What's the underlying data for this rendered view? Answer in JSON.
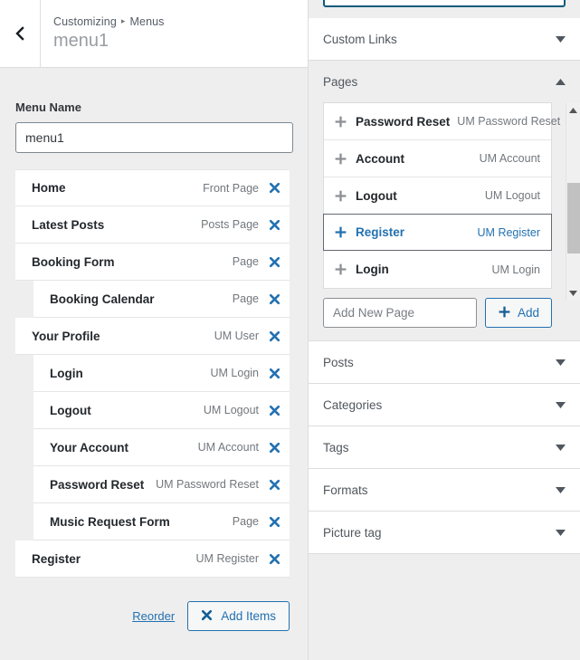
{
  "colors": {
    "accent": "#2271b1",
    "panel_bg": "#eeeeee",
    "row_bg": "#ffffff",
    "title_text": "#23282d",
    "type_text": "#72777c",
    "header_title": "#999da1",
    "focus_border": "#0d5a7d"
  },
  "left_panel": {
    "back_button_label": "Back",
    "breadcrumb": {
      "root": "Customizing",
      "separator": "▸",
      "current": "Menus"
    },
    "panel_title": "menu1",
    "menu_name_label": "Menu Name",
    "menu_name_value": "menu1",
    "menu_items": [
      {
        "title": "Home",
        "type": "Front Page",
        "depth": 0,
        "remove_label": "Remove"
      },
      {
        "title": "Latest Posts",
        "type": "Posts Page",
        "depth": 0,
        "remove_label": "Remove"
      },
      {
        "title": "Booking Form",
        "type": "Page",
        "depth": 0,
        "remove_label": "Remove"
      },
      {
        "title": "Booking Calendar",
        "type": "Page",
        "depth": 1,
        "remove_label": "Remove"
      },
      {
        "title": "Your Profile",
        "type": "UM User",
        "depth": 0,
        "remove_label": "Remove"
      },
      {
        "title": "Login",
        "type": "UM Login",
        "depth": 1,
        "remove_label": "Remove"
      },
      {
        "title": "Logout",
        "type": "UM Logout",
        "depth": 1,
        "remove_label": "Remove"
      },
      {
        "title": "Your Account",
        "type": "UM Account",
        "depth": 1,
        "remove_label": "Remove"
      },
      {
        "title": "Password Reset",
        "type": "UM Password Reset",
        "depth": 1,
        "remove_label": "Remove"
      },
      {
        "title": "Music Request Form",
        "type": "Page",
        "depth": 1,
        "remove_label": "Remove"
      },
      {
        "title": "Register",
        "type": "UM Register",
        "depth": 0,
        "remove_label": "Remove"
      }
    ],
    "reorder_label": "Reorder",
    "add_items_label": "Add Items"
  },
  "right_panel": {
    "sections": [
      {
        "title": "Custom Links",
        "expanded": false
      },
      {
        "title": "Pages",
        "expanded": true
      },
      {
        "title": "Posts",
        "expanded": false
      },
      {
        "title": "Categories",
        "expanded": false
      },
      {
        "title": "Tags",
        "expanded": false
      },
      {
        "title": "Formats",
        "expanded": false
      },
      {
        "title": "Picture tag",
        "expanded": false
      }
    ],
    "pages_section": {
      "items": [
        {
          "title": "Password Reset",
          "type": "UM Password Reset",
          "hovered": false
        },
        {
          "title": "Account",
          "type": "UM Account",
          "hovered": false
        },
        {
          "title": "Logout",
          "type": "UM Logout",
          "hovered": false
        },
        {
          "title": "Register",
          "type": "UM Register",
          "hovered": true
        },
        {
          "title": "Login",
          "type": "UM Login",
          "hovered": false
        }
      ],
      "add_new_placeholder": "Add New Page",
      "add_new_value": "",
      "add_button_label": "Add"
    }
  }
}
